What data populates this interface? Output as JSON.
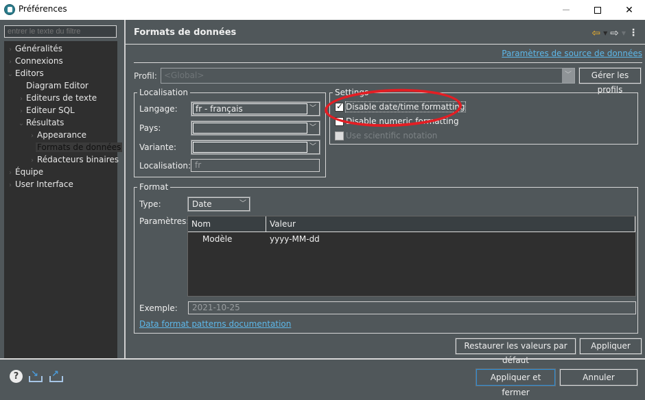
{
  "window": {
    "title": "Préférences",
    "controls": {
      "minimize": "—",
      "maximize": "☐",
      "close": "✕"
    }
  },
  "sidebar": {
    "filter_placeholder": "entrer le texte du filtre",
    "items": [
      {
        "label": "Généralités",
        "level": 0,
        "expander": "collapsed"
      },
      {
        "label": "Connexions",
        "level": 0,
        "expander": "collapsed"
      },
      {
        "label": "Editors",
        "level": 0,
        "expander": "expanded"
      },
      {
        "label": "Diagram Editor",
        "level": 1,
        "expander": "none"
      },
      {
        "label": "Editeurs de texte",
        "level": 1,
        "expander": "collapsed"
      },
      {
        "label": "Editeur SQL",
        "level": 1,
        "expander": "collapsed"
      },
      {
        "label": "Résultats",
        "level": 1,
        "expander": "expanded"
      },
      {
        "label": "Appearance",
        "level": 2,
        "expander": "collapsed"
      },
      {
        "label": "Formats de données",
        "level": 2,
        "expander": "none",
        "selected": true
      },
      {
        "label": "Rédacteurs binaires",
        "level": 2,
        "expander": "collapsed"
      },
      {
        "label": "Équipe",
        "level": 0,
        "expander": "collapsed"
      },
      {
        "label": "User Interface",
        "level": 0,
        "expander": "collapsed"
      }
    ]
  },
  "page": {
    "title": "Formats de données",
    "nav": {
      "back": "⇦",
      "forward": "⇨",
      "menu": "⋮",
      "dropdown": "▼"
    },
    "datasource_link": "Paramètres de source de données",
    "profile": {
      "label": "Profil:",
      "value": "<Global>",
      "manage_button": "Gérer les profils"
    },
    "localisation": {
      "legend": "Localisation",
      "language_label": "Langage:",
      "language_value": "fr - français",
      "country_label": "Pays:",
      "country_value": "",
      "variant_label": "Variante:",
      "variant_value": "",
      "locale_label": "Localisation:",
      "locale_value": "fr"
    },
    "settings": {
      "legend": "Settings",
      "options": [
        {
          "label": "Disable date/time formatting",
          "checked": true,
          "enabled": true
        },
        {
          "label": "Disable numeric formatting",
          "checked": false,
          "enabled": true
        },
        {
          "label": "Use scientific notation",
          "checked": false,
          "enabled": false
        }
      ]
    },
    "format": {
      "legend": "Format",
      "type_label": "Type:",
      "type_value": "Date",
      "params_label": "Paramètres:",
      "columns": [
        "Nom",
        "Valeur"
      ],
      "rows": [
        {
          "name": "Modèle",
          "value": "yyyy-MM-dd"
        }
      ],
      "example_label": "Exemple:",
      "example_value": "2021-10-25",
      "doc_link": "Data format patterns documentation"
    },
    "restore_button": "Restaurer les valeurs par défaut",
    "apply_button": "Appliquer"
  },
  "footer": {
    "apply_close_button": "Appliquer et fermer",
    "cancel_button": "Annuler"
  },
  "colors": {
    "annotation": "#e31e24",
    "link": "#5db8ea",
    "back_arrow": "#f2b42c"
  }
}
